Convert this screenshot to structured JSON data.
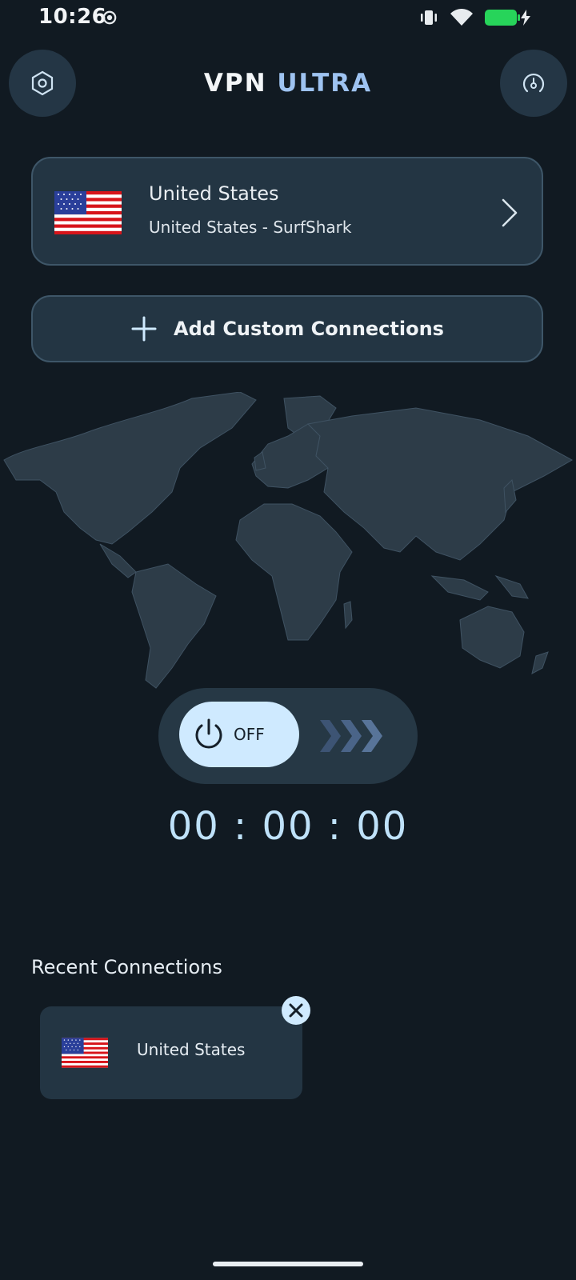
{
  "status_bar": {
    "time": "10:26"
  },
  "header": {
    "title_part1": "VPN",
    "title_part2": "ULTRA",
    "left_icon": "settings-hex-icon",
    "right_icon": "speedometer-icon"
  },
  "server": {
    "country": "United States",
    "detail": "United States - SurfShark"
  },
  "add_custom": {
    "label": "Add Custom Connections"
  },
  "toggle": {
    "state_label": "OFF"
  },
  "timer": {
    "value": "00 : 00 : 00"
  },
  "recent": {
    "title": "Recent Connections",
    "items": [
      {
        "country": "United States"
      }
    ]
  },
  "colors": {
    "background": "#111a22",
    "card": "#233543",
    "accent": "#9ec3f1",
    "toggle_knob": "#cfeaff"
  }
}
